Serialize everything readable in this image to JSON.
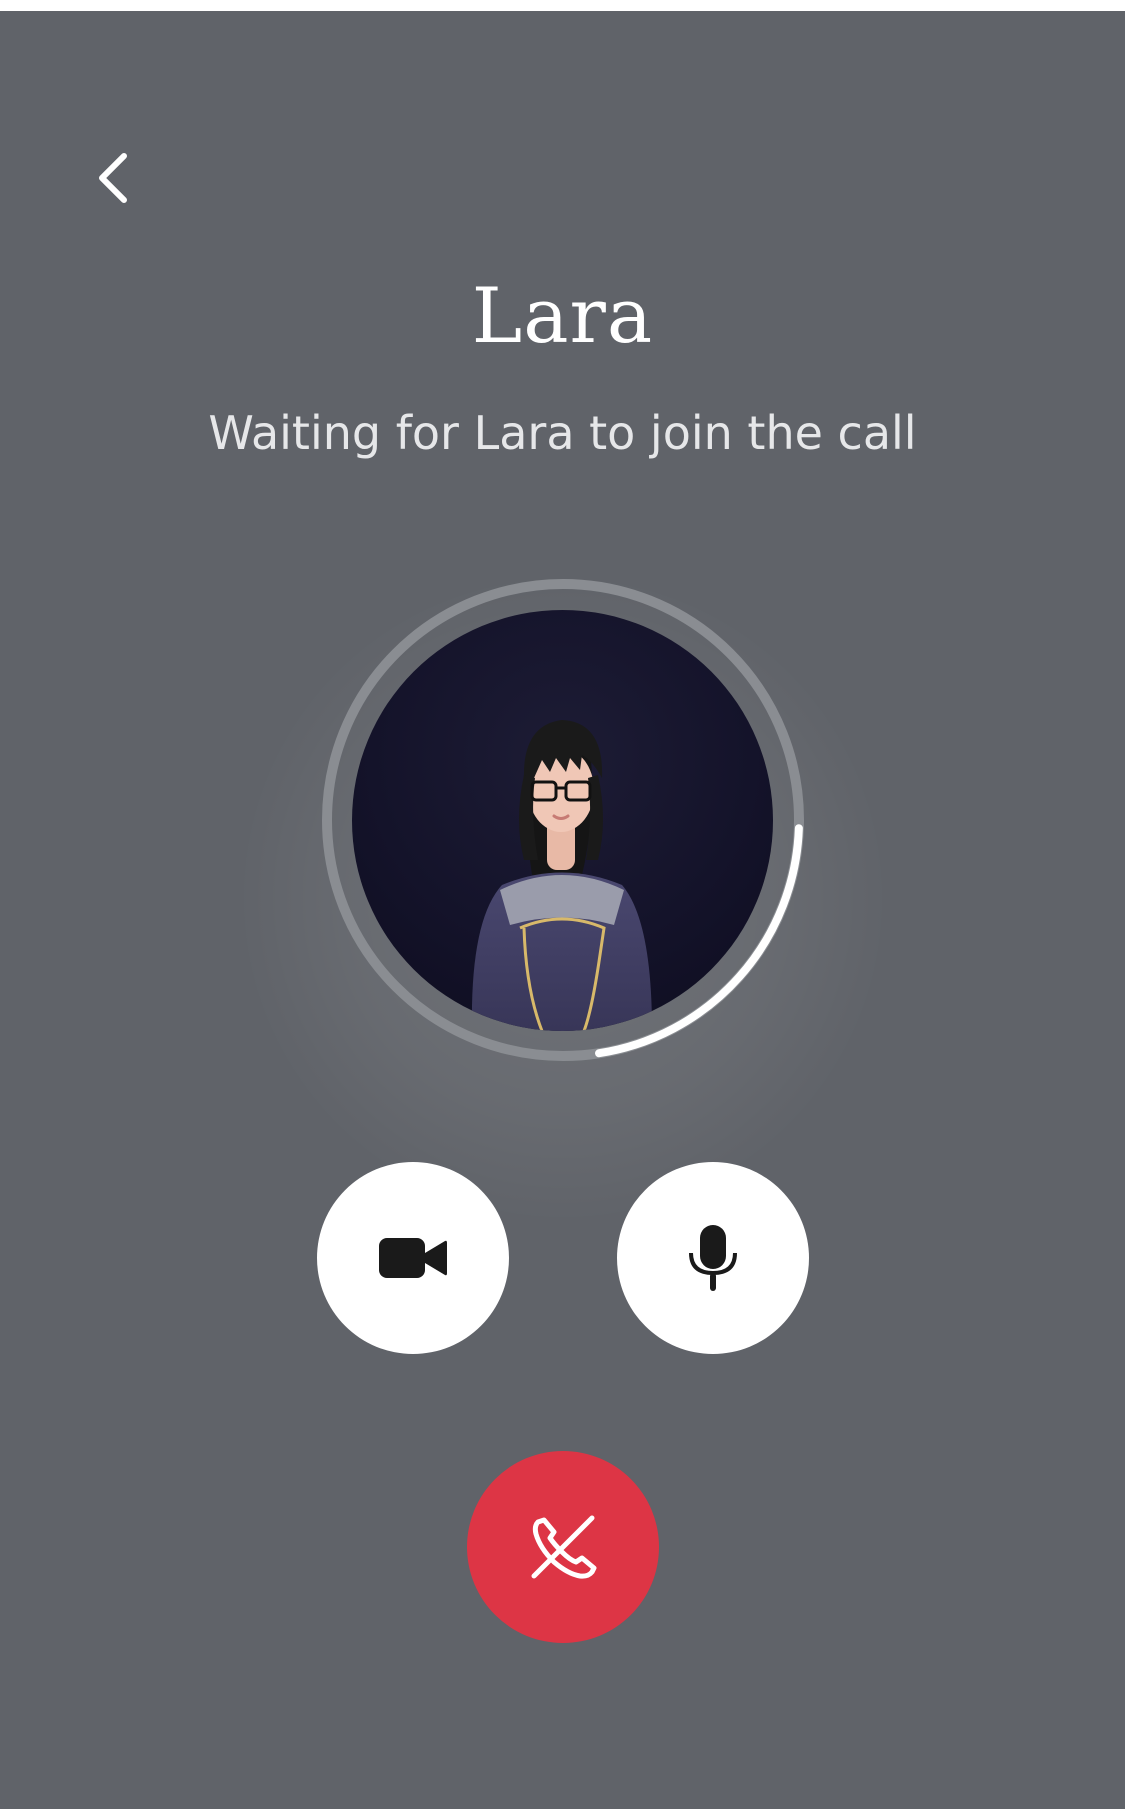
{
  "call": {
    "caller_name": "Lara",
    "status_text": "Waiting for Lara to join the call",
    "connection_progress": 0.22
  },
  "controls": {
    "back_icon": "chevron-left-icon",
    "video_icon": "video-camera-icon",
    "mic_icon": "microphone-icon",
    "end_call_icon": "phone-hangup-icon"
  },
  "colors": {
    "background": "#606369",
    "end_call": "#dd3545",
    "control_button": "#ffffff",
    "ring_track": "#8a8d92",
    "ring_progress": "#ffffff"
  }
}
